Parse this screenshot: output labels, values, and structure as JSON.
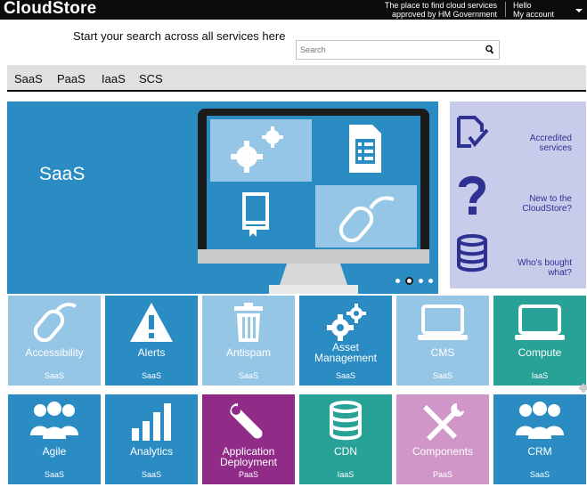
{
  "header": {
    "logo": "CloudStore",
    "tagline_line1": "The place to find cloud services",
    "tagline_line2": "approved by HM Government",
    "greeting": "Hello",
    "account_label": "My account"
  },
  "search": {
    "label": "Start your search across all services here",
    "placeholder": "Search"
  },
  "nav": {
    "items": [
      "SaaS",
      "PaaS",
      "IaaS",
      "SCS"
    ]
  },
  "hero": {
    "title": "SaaS",
    "slides_total": 4,
    "active_slide": 2
  },
  "sidepanel": {
    "items": [
      {
        "line1": "Accredited",
        "line2": "services",
        "icon": "checked-document-icon"
      },
      {
        "line1": "New to the",
        "line2": "CloudStore?",
        "icon": "question-mark-icon"
      },
      {
        "line1": "Who's bought",
        "line2": "what?",
        "icon": "database-icon"
      }
    ]
  },
  "tiles": [
    {
      "line1": "Accessibility",
      "line2": "",
      "category": "SaaS",
      "icon": "mouse-icon",
      "color": "#96c6e6"
    },
    {
      "line1": "Alerts",
      "line2": "",
      "category": "SaaS",
      "icon": "warning-icon",
      "color": "#2b8cc4"
    },
    {
      "line1": "Antispam",
      "line2": "",
      "category": "SaaS",
      "icon": "trash-icon",
      "color": "#96c6e6"
    },
    {
      "line1": "Asset",
      "line2": "Management",
      "category": "SaaS",
      "icon": "gears-icon",
      "color": "#2b8cc4"
    },
    {
      "line1": "CMS",
      "line2": "",
      "category": "SaaS",
      "icon": "laptop-icon",
      "color": "#96c6e6"
    },
    {
      "line1": "Compute",
      "line2": "",
      "category": "IaaS",
      "icon": "laptop-icon",
      "color": "#28a197"
    },
    {
      "line1": "Agile",
      "line2": "",
      "category": "SaaS",
      "icon": "people-icon",
      "color": "#2b8cc4"
    },
    {
      "line1": "Analytics",
      "line2": "",
      "category": "SaaS",
      "icon": "bar-chart-icon",
      "color": "#2b8cc4"
    },
    {
      "line1": "Application",
      "line2": "Deployment",
      "category": "PaaS",
      "icon": "wrench-icon",
      "color": "#912b88"
    },
    {
      "line1": "CDN",
      "line2": "",
      "category": "IaaS",
      "icon": "database-icon",
      "color": "#28a197"
    },
    {
      "line1": "Components",
      "line2": "",
      "category": "PaaS",
      "icon": "tools-icon",
      "color": "#d096c8"
    },
    {
      "line1": "CRM",
      "line2": "",
      "category": "SaaS",
      "icon": "people-icon",
      "color": "#2b8cc4"
    }
  ]
}
